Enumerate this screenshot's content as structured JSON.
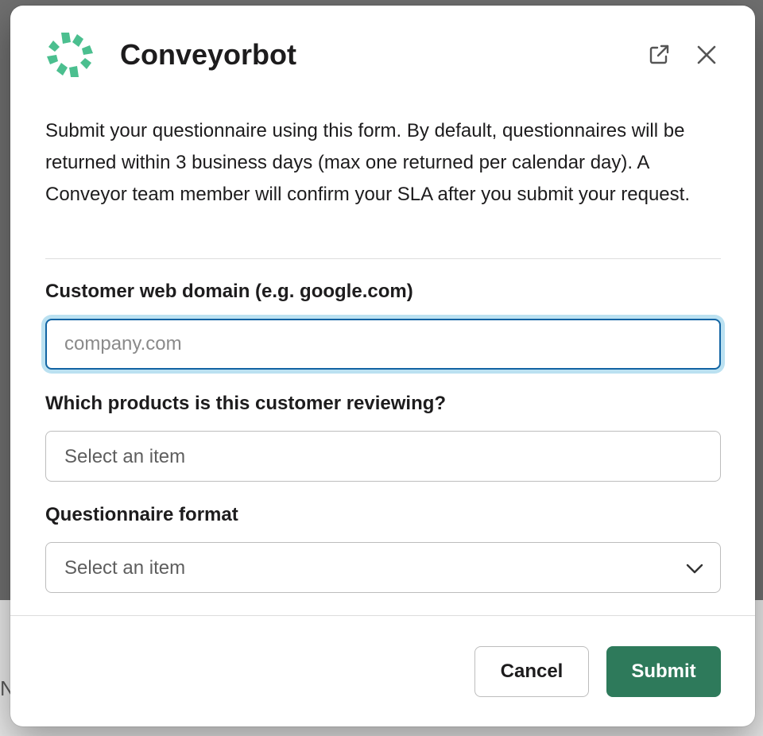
{
  "app": {
    "title": "Conveyorbot",
    "logo_icon": "conveyorbot-logo",
    "brand_color": "#4bbf8f"
  },
  "header": {
    "open_in_new_icon": "external-link-icon",
    "close_icon": "close-icon"
  },
  "description": "Submit your questionnaire using this form. By default, questionnaires will be returned within 3 business days (max one returned per calendar day). A Conveyor team member will confirm your SLA after you submit your request.",
  "form": {
    "domain": {
      "label": "Customer web domain (e.g. google.com)",
      "placeholder": "company.com",
      "value": ""
    },
    "products": {
      "label": "Which products is this customer reviewing?",
      "placeholder": "Select an item"
    },
    "format": {
      "label": "Questionnaire format",
      "placeholder": "Select an item",
      "chevron_icon": "chevron-down-icon"
    }
  },
  "footer": {
    "cancel_label": "Cancel",
    "submit_label": "Submit",
    "submit_color": "#2e7a5b"
  },
  "background": {
    "partial_text": "N"
  }
}
